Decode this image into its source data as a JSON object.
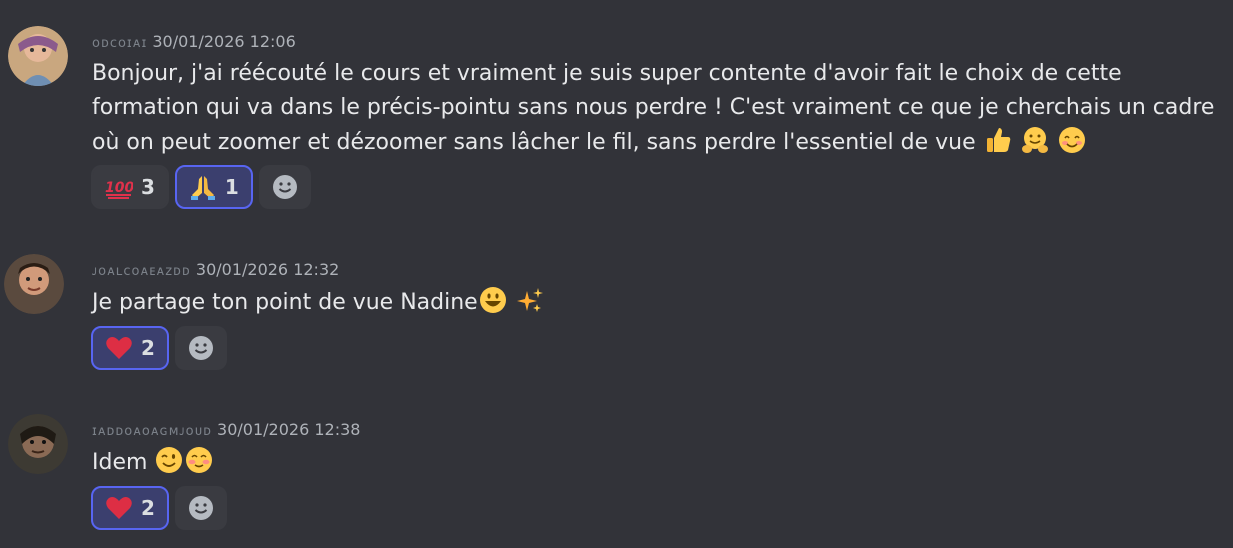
{
  "messages": [
    {
      "author": "ᴏᴅᴄᴏɪᴀɪ",
      "timestamp": "30/01/2026 12:06",
      "text": "Bonjour, j'ai réécouté le cours et vraiment je suis super contente d'avoir fait le choix de cette formation qui va dans le précis-pointu sans nous perdre ! C'est vraiment ce que je cherchais un cadre où on peut zoomer et dézoomer sans lâcher le fil, sans perdre l'essentiel de vue",
      "emojis": [
        "thumbs-up",
        "hugging-face",
        "smiling-face"
      ],
      "reactions": [
        {
          "emoji": "hundred-points",
          "count": "3",
          "me": false
        },
        {
          "emoji": "folded-hands",
          "count": "1",
          "me": true
        }
      ]
    },
    {
      "author": "ᴊᴏᴀʟᴄᴏᴀᴇᴀᴢᴅᴅ",
      "timestamp": "30/01/2026 12:32",
      "text": "Je partage ton point de vue Nadine",
      "emojis": [
        "grinning-face",
        "sparkles"
      ],
      "reactions": [
        {
          "emoji": "red-heart",
          "count": "2",
          "me": true
        }
      ]
    },
    {
      "author": "ɪᴀᴅᴅᴏᴀᴏᴀɢᴍᴊᴏᴜᴅ",
      "timestamp": "30/01/2026 12:38",
      "text": "Idem",
      "emojis": [
        "winking-face",
        "blushing-face"
      ],
      "reactions": [
        {
          "emoji": "red-heart",
          "count": "2",
          "me": true
        }
      ]
    }
  ],
  "colors": {
    "background": "#323339",
    "reaction_bg": "#3a3b41",
    "reaction_me_bg": "#3b3f6e",
    "reaction_me_border": "#5865f2",
    "timestamp": "#aeb2b8"
  }
}
